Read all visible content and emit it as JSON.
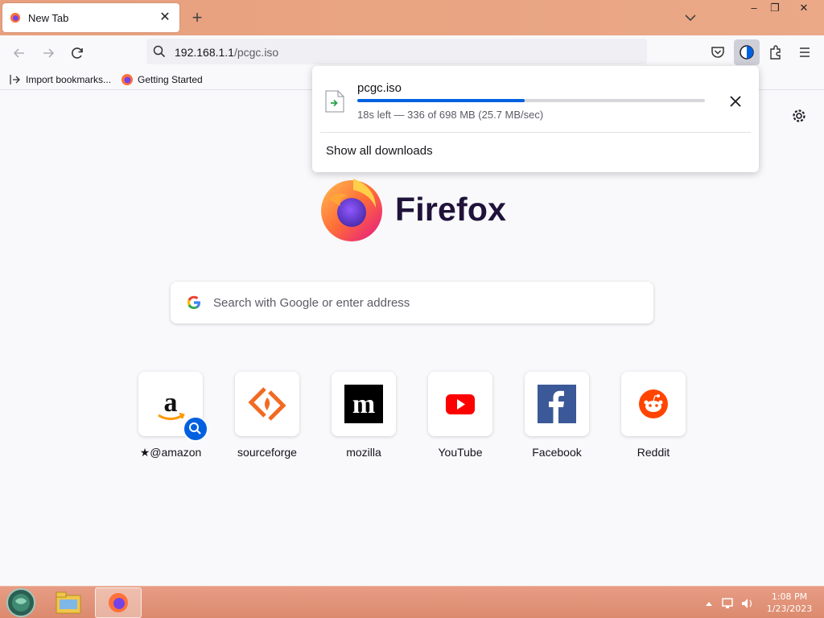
{
  "window": {
    "tab_title": "New Tab",
    "tab_close_glyph": "✕",
    "new_tab_glyph": "+",
    "minimize_glyph": "–",
    "maximize_glyph": "❐",
    "close_glyph": "✕"
  },
  "navbar": {
    "url_host": "192.168.1.1",
    "url_path": "/pcgc.iso",
    "icons": [
      "back-icon",
      "forward-icon",
      "reload-icon",
      "search-icon",
      "pocket-icon",
      "downloads-icon",
      "extensions-icon",
      "menu-icon"
    ]
  },
  "bookmarks": {
    "items": [
      {
        "label": "Import bookmarks...",
        "icon": "import-icon"
      },
      {
        "label": "Getting Started",
        "icon": "firefox-icon"
      }
    ]
  },
  "download": {
    "filename": "pcgc.iso",
    "status": "18s left — 336 of 698 MB (25.7 MB/sec)",
    "progress": 0.481,
    "show_all_label": "Show all downloads"
  },
  "newtab": {
    "brand": "Firefox",
    "search_placeholder": "Search with Google or enter address",
    "sites": [
      {
        "label": "@amazon",
        "pinned": true,
        "icon": "amazon-icon"
      },
      {
        "label": "sourceforge",
        "icon": "sourceforge-icon"
      },
      {
        "label": "mozilla",
        "icon": "mozilla-icon"
      },
      {
        "label": "YouTube",
        "icon": "youtube-icon"
      },
      {
        "label": "Facebook",
        "icon": "facebook-icon"
      },
      {
        "label": "Reddit",
        "icon": "reddit-icon"
      }
    ]
  },
  "taskbar": {
    "time": "1:08 PM",
    "date": "1/23/2023"
  },
  "colors": {
    "accent": "#0061e0",
    "titlebar": "#e9a583",
    "taskbar": "#e09276"
  }
}
